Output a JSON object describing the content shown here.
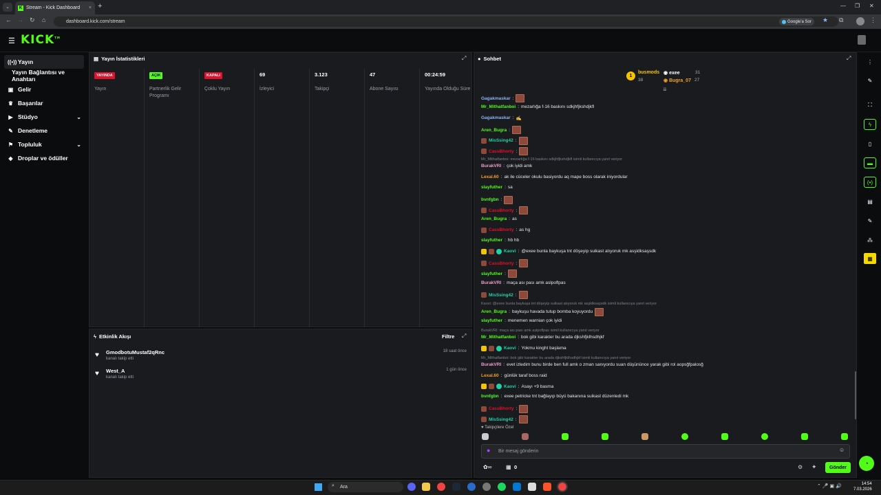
{
  "browser": {
    "tab_title": "Stream - Kick Dashboard",
    "url": "dashboard.kick.com/stream",
    "google_btn": "Google'a Sor"
  },
  "sidebar": {
    "items": [
      {
        "label": "Yayın",
        "icon": "broadcast-icon"
      },
      {
        "label": "Yayın Bağlantısı ve Anahtarı",
        "icon": ""
      },
      {
        "label": "Gelir",
        "icon": "wallet-icon"
      },
      {
        "label": "Başarılar",
        "icon": "trophy-icon"
      },
      {
        "label": "Stüdyo",
        "icon": "studio-icon"
      },
      {
        "label": "Denetleme",
        "icon": "wrench-icon"
      },
      {
        "label": "Topluluk",
        "icon": "community-icon"
      },
      {
        "label": "Droplar ve ödüller",
        "icon": "gift-icon"
      }
    ]
  },
  "stats": {
    "title": "Yayın İstatistikleri",
    "cols": [
      {
        "value": "YAYINDA",
        "label": "Yayın",
        "kind": "pill-red"
      },
      {
        "value": "AÇIK",
        "label": "Partnerlik Gelir Programı",
        "kind": "pill-green"
      },
      {
        "value": "KAPALI",
        "label": "Çoklu Yayın",
        "kind": "pill-red"
      },
      {
        "value": "69",
        "label": "İzleyici",
        "kind": "text"
      },
      {
        "value": "3.123",
        "label": "Takipçi",
        "kind": "text"
      },
      {
        "value": "47",
        "label": "Abone Sayısı",
        "kind": "text"
      },
      {
        "value": "00:24:59",
        "label": "Yayında Olduğu Süre",
        "kind": "text"
      }
    ]
  },
  "activity": {
    "title": "Etkinlik Akışı",
    "filter": "Filtre",
    "items": [
      {
        "name": "GmodbotuMustaf2qRnc",
        "sub": "kanalı takip etti",
        "time": "18 saat önce"
      },
      {
        "name": "West_A",
        "sub": "kanalı takip etti",
        "time": "1 gün önce"
      }
    ]
  },
  "chat": {
    "title": "Sohbet",
    "leaders": [
      {
        "name": "busmods",
        "count": "38"
      },
      {
        "name": "exee",
        "count": "31"
      },
      {
        "name": "Bugra_07",
        "count": "27"
      }
    ],
    "messages": [
      {
        "user": "Gagakmaskar",
        "color": "#8ab4f8",
        "text": "",
        "emote": true,
        "badges": 0
      },
      {
        "user": "Mr_Mithatfanboi",
        "color": "#53fc18",
        "text": "mezarlığa f-16 baskını sdkjhfjkshdjkfl",
        "emote": false,
        "badges": 0
      },
      {
        "user": "Gagakmaskar",
        "color": "#8ab4f8",
        "text": "✍",
        "emote": false,
        "badges": 0
      },
      {
        "user": "Aren_Bugra",
        "color": "#53fc18",
        "text": "",
        "emote": true,
        "badges": 0
      },
      {
        "user": "MisSsing42",
        "color": "#1fd1a6",
        "text": "",
        "emote": true,
        "badges": 1
      },
      {
        "user": "CassBhorty",
        "color": "#e0112b",
        "text": "",
        "emote": true,
        "badges": 1
      },
      {
        "user": "BurakVRI",
        "color": "#e8a0c8",
        "text": "çok iyidi amk",
        "emote": false,
        "badges": 0,
        "reply": "Mr_Mithatfanboi: mezarlığa f-16 baskını sdkjhfjkshdjkfl isimli kullanıcıya yanıt veriyor"
      },
      {
        "user": "Lexal.60",
        "color": "#f0a030",
        "text": "ak ile cüceler okulu basiyordu aq mape boss olarak iniyordular",
        "emote": false,
        "badges": 0
      },
      {
        "user": "slayfuther",
        "color": "#53fc18",
        "text": "sa",
        "emote": false,
        "badges": 0
      },
      {
        "user": "bvnfgbn",
        "color": "#53fc18",
        "text": "",
        "emote": true,
        "badges": 0
      },
      {
        "user": "CassBhorty",
        "color": "#e0112b",
        "text": "",
        "emote": true,
        "badges": 1
      },
      {
        "user": "Aren_Bugra",
        "color": "#53fc18",
        "text": "as",
        "emote": false,
        "badges": 0
      },
      {
        "user": "CassBhorty",
        "color": "#e0112b",
        "text": "as hg",
        "emote": false,
        "badges": 1
      },
      {
        "user": "slayfuther",
        "color": "#53fc18",
        "text": "hb hb",
        "emote": false,
        "badges": 0
      },
      {
        "user": "Kaovi",
        "color": "#1fd1a6",
        "text": "@exee bunla baykuşa tnt döşeyip suikast atıyoruk mk asşldksaşsdk",
        "emote": false,
        "badges": 3
      },
      {
        "user": "CassBhorty",
        "color": "#e0112b",
        "text": "",
        "emote": true,
        "badges": 1
      },
      {
        "user": "slayfuther",
        "color": "#53fc18",
        "text": "",
        "emote": true,
        "badges": 0
      },
      {
        "user": "BurakVRI",
        "color": "#e8a0c8",
        "text": "maça ası pası amk aslpoflpas",
        "emote": false,
        "badges": 0
      },
      {
        "user": "MisSsing42",
        "color": "#1fd1a6",
        "text": "",
        "emote": true,
        "badges": 1
      },
      {
        "user": "Aren_Bugra",
        "color": "#53fc18",
        "text": "baykuşu havada tutup bomba koyuyordu",
        "emote": true,
        "badges": 0,
        "reply": "Kaovi: @exee bunla baykuşa tnt döşeyip suikast atıyoruk mk asşldksaşsdk isimli kullanıcıya yanıt veriyor"
      },
      {
        "user": "slayfuther",
        "color": "#53fc18",
        "text": "menemen warnian çok iyidi",
        "emote": false,
        "badges": 0
      },
      {
        "user": "Mr_Mithatfanboi",
        "color": "#53fc18",
        "text": "bok gibi karakter bu arada djkshfjklhsdhjkf",
        "emote": false,
        "badges": 0,
        "reply": "BurakVRI: maça ası pası amk aslpoflpas isimli kullanıcıya yanıt veriyor"
      },
      {
        "user": "Kaovi",
        "color": "#1fd1a6",
        "text": "Yokmu kinght başlama",
        "emote": false,
        "badges": 3
      },
      {
        "user": "BurakVRI",
        "color": "#e8a0c8",
        "text": "evet izledim bunu birde ben full amk o zman sanıyordu suan düşününce yarak gibi rol aopsğfpalosğ",
        "emote": false,
        "badges": 0,
        "reply": "Mr_Mithatfanboi: bok gibi karakter bu arada djkshfjklhsdhjkf isimli kullanıcıya yanıt veriyor"
      },
      {
        "user": "Lexal.60",
        "color": "#f0a030",
        "text": "günlük taraf boss raid",
        "emote": false,
        "badges": 0
      },
      {
        "user": "Kaovi",
        "color": "#1fd1a6",
        "text": "Asayı +9 basma",
        "emote": false,
        "badges": 3
      },
      {
        "user": "bvnfgbn",
        "color": "#53fc18",
        "text": "exee petricke tnt bağlayıp büyü bakanına suikast düzenledi mk",
        "emote": false,
        "badges": 0
      },
      {
        "user": "CassBhorty",
        "color": "#e0112b",
        "text": "",
        "emote": true,
        "badges": 1
      },
      {
        "user": "MisSsing42",
        "color": "#1fd1a6",
        "text": "",
        "emote": true,
        "badges": 1
      }
    ],
    "followers_label": "Takipçilere Özel",
    "input_placeholder": "Bir mesaj gönderin",
    "points": "0",
    "send_label": "Gönder"
  },
  "taskbar": {
    "search": "Ara",
    "time": "14:54",
    "date": "7.03.2026"
  },
  "colors": {
    "accent": "#53fc18",
    "live_red": "#e0112b"
  }
}
